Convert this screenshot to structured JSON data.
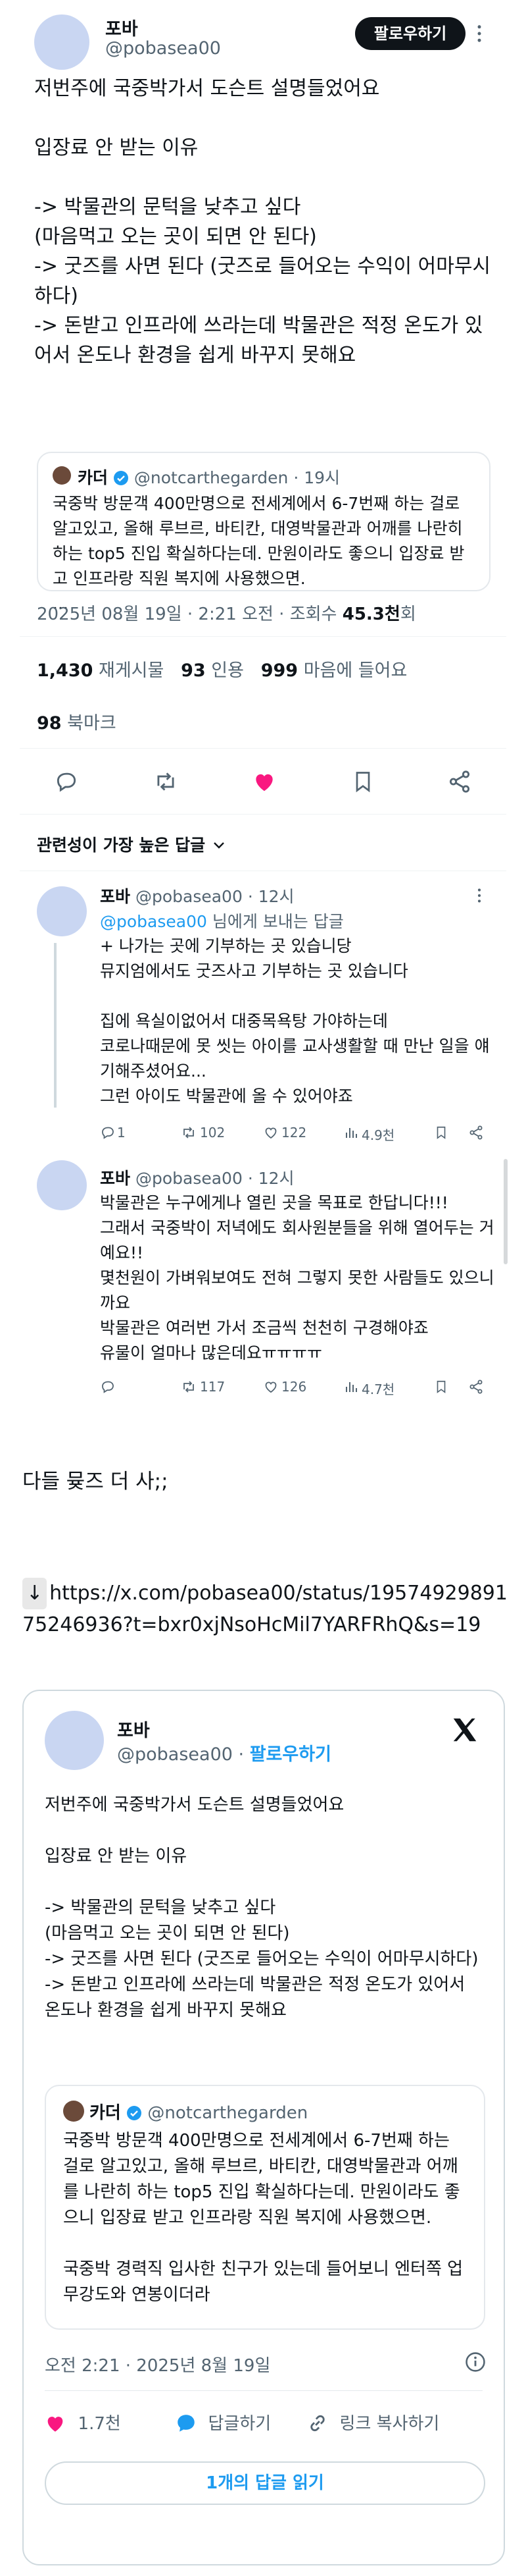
{
  "tweet": {
    "display_name": "포바",
    "handle": "@pobasea00",
    "follow_label": "팔로우하기",
    "body": "저번주에 국중박가서 도슨트 설명들었어요\n\n입장료 안 받는 이유\n\n-> 박물관의 문턱을 낮추고 싶다\n(마음먹고 오는 곳이 되면 안 된다)\n-> 굿즈를 사면 된다 (굿즈로 들어오는 수익이 어마무시하다)\n-> 돈받고 인프라에 쓰라는데 박물관은 적정 온도가 있어서 온도나 환경을 쉽게 바꾸지 못해요",
    "quote": {
      "display_name": "카더",
      "handle": "@notcarthegarden",
      "time": "· 19시",
      "body": "국중박 방문객 400만명으로 전세계에서 6-7번째 하는 걸로 알고있고, 올해 루브르, 바티칸, 대영박물관과 어깨를 나란히 하는 top5 진입 확실하다는데. 만원이라도 좋으니 입장료 받고 인프라랑 직원 복지에 사용했으면.\n..."
    },
    "timestamp": "2025년 08월 19일 · 2:21 오전 · 조회수",
    "views": "45.3천",
    "views_suffix": "회",
    "retweets": "1,430",
    "retweets_label": "재게시물",
    "quotes": "93",
    "quotes_label": "인용",
    "likes": "999",
    "likes_label": "마음에 들어요",
    "bookmarks": "98",
    "bookmarks_label": "북마크",
    "sort_label": "관련성이 가장 높은 답글"
  },
  "replies": [
    {
      "display_name": "포바",
      "handle": "@pobasea00",
      "time": "· 12시",
      "replying_to": "@pobasea00",
      "replying_suffix": " 님에게 보내는 답글",
      "body": "+ 나가는 곳에 기부하는 곳 있습니당\n뮤지엄에서도 굿즈사고 기부하는 곳 있습니다\n\n집에 욕실이없어서 대중목욕탕 가야하는데\n코로나때문에 못 씻는 아이를 교사생활할 때 만난 일을 얘기해주셨어요...\n그런 아이도 박물관에 올 수 있어야죠",
      "reply_count": "1",
      "retweet_count": "102",
      "like_count": "122",
      "view_count": "4.9천"
    },
    {
      "display_name": "포바",
      "handle": "@pobasea00",
      "time": "· 12시",
      "body": "박물관은 누구에게나 열린 곳을 목표로 한답니다!!!\n그래서 국중박이 저녁에도 회사원분들을 위해 열어두는 거예요!!\n몇천원이 가벼워보여도 전혀 그렇지 못한 사람들도 있으니까요\n박물관은 여러번 가서 조금씩 천천히 구경해야죠\n유물이 얼마나 많은데요ㅠㅠㅠㅠ",
      "reply_count": "",
      "retweet_count": "117",
      "like_count": "126",
      "view_count": "4.7천"
    }
  ],
  "post": {
    "comment": "다들 뮺즈 더 사;;",
    "arrow": "↓",
    "link": "https://x.com/pobasea00/status/1957492989175246936?t=bxr0xjNsoHcMil7YARFRhQ&s=19"
  },
  "embed": {
    "display_name": "포바",
    "handle": "@pobasea00",
    "dot": "·",
    "follow_label": "팔로우하기",
    "body": "저번주에 국중박가서 도슨트 설명들었어요\n\n입장료 안 받는 이유\n\n-> 박물관의 문턱을 낮추고 싶다\n(마음먹고 오는 곳이 되면 안 된다)\n-> 굿즈를 사면 된다 (굿즈로 들어오는 수익이 어마무시하다)\n-> 돈받고 인프라에 쓰라는데 박물관은 적정 온도가 있어서 온도나 환경을 쉽게 바꾸지 못해요",
    "quote": {
      "display_name": "카더",
      "handle": "@notcarthegarden",
      "body": "국중박 방문객 400만명으로 전세계에서 6-7번째 하는 걸로 알고있고, 올해 루브르, 바티칸, 대영박물관과 어깨를 나란히 하는 top5 진입 확실하다는데. 만원이라도 좋으니 입장료 받고 인프라랑 직원 복지에 사용했으면.\n\n국중박 경력직 입사한 친구가 있는데 들어보니 엔터쪽 업무강도와 연봉이더라"
    },
    "timestamp": "오전 2:21 · 2025년 8월 19일",
    "likes": "1.7천",
    "reply_label": "답글하기",
    "copy_label": "링크 복사하기",
    "read_label": "1개의 답글 읽기"
  },
  "colors": {
    "accent": "#1d9bf0",
    "like": "#f91880",
    "text": "#0f1419",
    "muted": "#536471"
  }
}
